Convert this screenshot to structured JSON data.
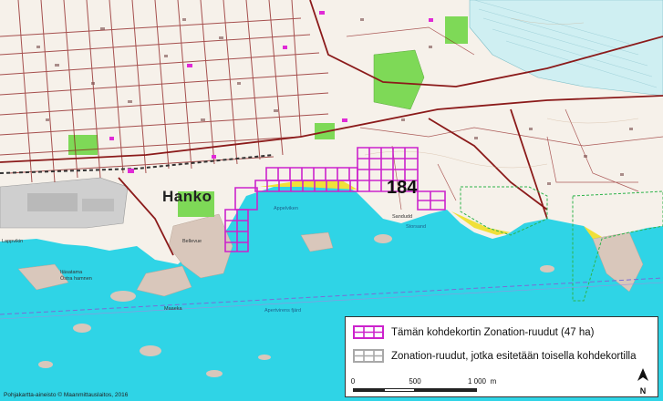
{
  "map": {
    "town_label": "Hanko",
    "card_number": "184",
    "credit": "Pohjakartta-aineisto © Maanmittauslaitos, 2016",
    "place_labels": [
      "Lappvikin",
      "Itäsatama",
      "Östra hamnen",
      "Maaeka",
      "Sandudd",
      "Bellevue"
    ],
    "water_labels": [
      "Appelviken",
      "Storsand",
      "Apertvirens fjärd"
    ]
  },
  "legend": {
    "item_own": "Tämän kohdekortin Zonation-ruudut (47 ha)",
    "item_other": "Zonation-ruudut, jotka esitetään toisella kohdekortilla",
    "own_color": "#cc22cc",
    "other_color": "#a8a8a8",
    "scale_labels": [
      "0",
      "500",
      "1 000"
    ],
    "scale_unit": "m",
    "north_label": "N"
  },
  "colors": {
    "sea": "#2fd4e6",
    "land": "#f6f1ea",
    "road": "#8b1a1a",
    "forest": "#7ed957",
    "rock": "#d9c7bb",
    "sand": "#f0e03a",
    "marsh": "#cfeff2",
    "industrial": "#cfcfcf"
  }
}
